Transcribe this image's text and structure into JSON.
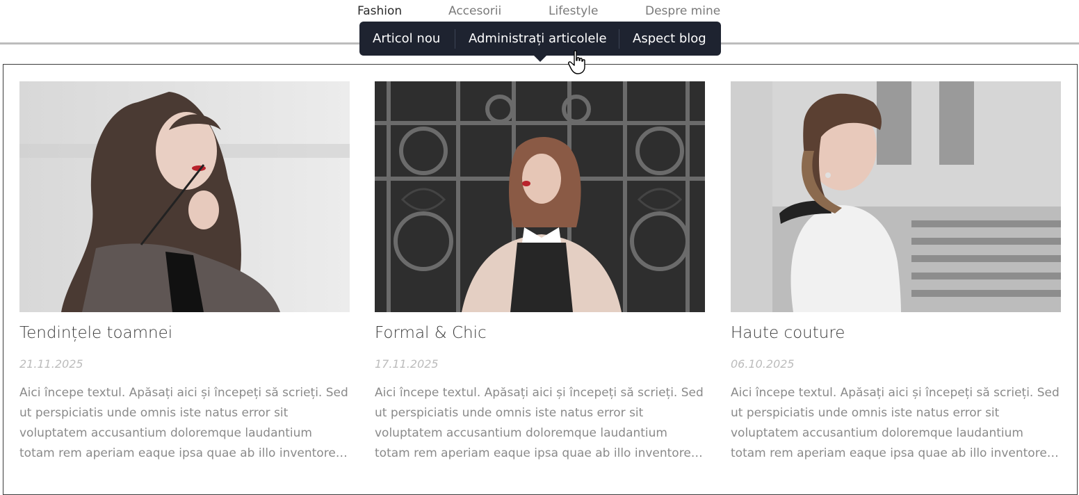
{
  "nav": {
    "items": [
      {
        "label": "Fashion",
        "active": true
      },
      {
        "label": "Accesorii",
        "active": false
      },
      {
        "label": "Lifestyle",
        "active": false
      },
      {
        "label": "Despre mine",
        "active": false
      }
    ]
  },
  "toolbar": {
    "buttons": [
      {
        "label": "Articol nou"
      },
      {
        "label": "Administrați articolele"
      },
      {
        "label": "Aspect blog"
      }
    ],
    "bg_color": "#1e2330"
  },
  "posts": [
    {
      "title": "Tendințele toamnei",
      "date": "21.11.2025",
      "excerpt": "Aici începe textul. Apăsați aici și începeți să scrieți. Sed ut perspiciatis unde omnis iste natus error sit voluptatem accusantium doloremque laudantium totam rem aperiam eaque ipsa quae ab illo inventore…"
    },
    {
      "title": "Formal & Chic",
      "date": "17.11.2025",
      "excerpt": "Aici începe textul. Apăsați aici și începeți să scrieți. Sed ut perspiciatis unde omnis iste natus error sit voluptatem accusantium doloremque laudantium totam rem aperiam eaque ipsa quae ab illo inventore…"
    },
    {
      "title": "Haute couture",
      "date": "06.10.2025",
      "excerpt": "Aici începe textul. Apăsați aici și începeți să scrieți. Sed ut perspiciatis unde omnis iste natus error sit voluptatem accusantium doloremque laudantium totam rem aperiam eaque ipsa quae ab illo inventore…"
    }
  ],
  "icons": {
    "cursor": "hand-pointer-cursor-icon"
  }
}
